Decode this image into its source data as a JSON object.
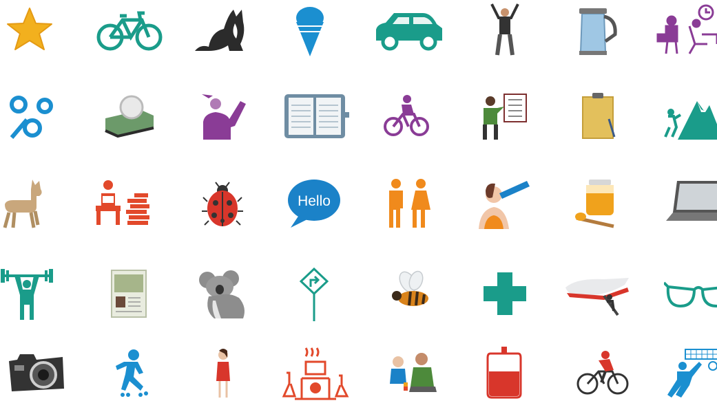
{
  "icons": [
    {
      "name": "star-icon",
      "color": "#f2b01e"
    },
    {
      "name": "bicycle-icon",
      "color": "#1a9c8a"
    },
    {
      "name": "cat-icon",
      "color": "#2b2b2b"
    },
    {
      "name": "ice-cream-icon",
      "color": "#1b8fd0"
    },
    {
      "name": "car-icon",
      "color": "#1a9c8a"
    },
    {
      "name": "celebrating-man-icon",
      "color": "#333333"
    },
    {
      "name": "kettle-icon",
      "color": "#9fc7e4"
    },
    {
      "name": "office-worker-clock-icon",
      "color": "#8a3c96"
    },
    {
      "name": "gears-icon",
      "color": "#1b8fd0"
    },
    {
      "name": "tape-dispenser-icon",
      "color": "#6c9a6a"
    },
    {
      "name": "person-waving-icon",
      "color": "#8a3c96"
    },
    {
      "name": "planner-book-icon",
      "color": "#6f8da3"
    },
    {
      "name": "cyclist-icon",
      "color": "#8a3c96"
    },
    {
      "name": "presenter-icon",
      "color": "#4d8a3b"
    },
    {
      "name": "clipboard-icon",
      "color": "#e3c05c"
    },
    {
      "name": "mountain-climber-icon",
      "color": "#1a9c8a"
    },
    {
      "name": "llama-icon",
      "color": "#c9a77c"
    },
    {
      "name": "reading-coins-icon",
      "color": "#e2492b"
    },
    {
      "name": "ladybug-icon",
      "color": "#d8362b"
    },
    {
      "name": "hello-speech-bubble-icon",
      "color": "#1b82c8"
    },
    {
      "name": "people-talking-icon",
      "color": "#f08a1c"
    },
    {
      "name": "woman-drinking-icon",
      "color": "#f08a1c"
    },
    {
      "name": "honey-jar-icon",
      "color": "#f0a21c"
    },
    {
      "name": "laptop-icon",
      "color": "#555555"
    },
    {
      "name": "weightlifter-icon",
      "color": "#1a9c8a"
    },
    {
      "name": "passport-icon",
      "color": "#a6b58a"
    },
    {
      "name": "koala-icon",
      "color": "#8d8d8d"
    },
    {
      "name": "turn-right-sign-icon",
      "color": "#1a9c8a"
    },
    {
      "name": "bee-icon",
      "color": "#d9831b"
    },
    {
      "name": "medical-cross-icon",
      "color": "#1a9c8a"
    },
    {
      "name": "airplane-boarding-icon",
      "color": "#d8362b"
    },
    {
      "name": "glasses-icon",
      "color": "#1a9c8a"
    },
    {
      "name": "camera-icon",
      "color": "#333333"
    },
    {
      "name": "roller-skater-icon",
      "color": "#1b8fd0"
    },
    {
      "name": "woman-red-dress-icon",
      "color": "#d8362b"
    },
    {
      "name": "laboratory-icon",
      "color": "#e2492b"
    },
    {
      "name": "children-playing-icon",
      "color": "#4d8a3b"
    },
    {
      "name": "blood-bag-icon",
      "color": "#d8362b"
    },
    {
      "name": "road-cyclist-icon",
      "color": "#d8362b"
    },
    {
      "name": "volleyball-player-icon",
      "color": "#1b8fd0"
    }
  ],
  "hello_text": "Hello"
}
